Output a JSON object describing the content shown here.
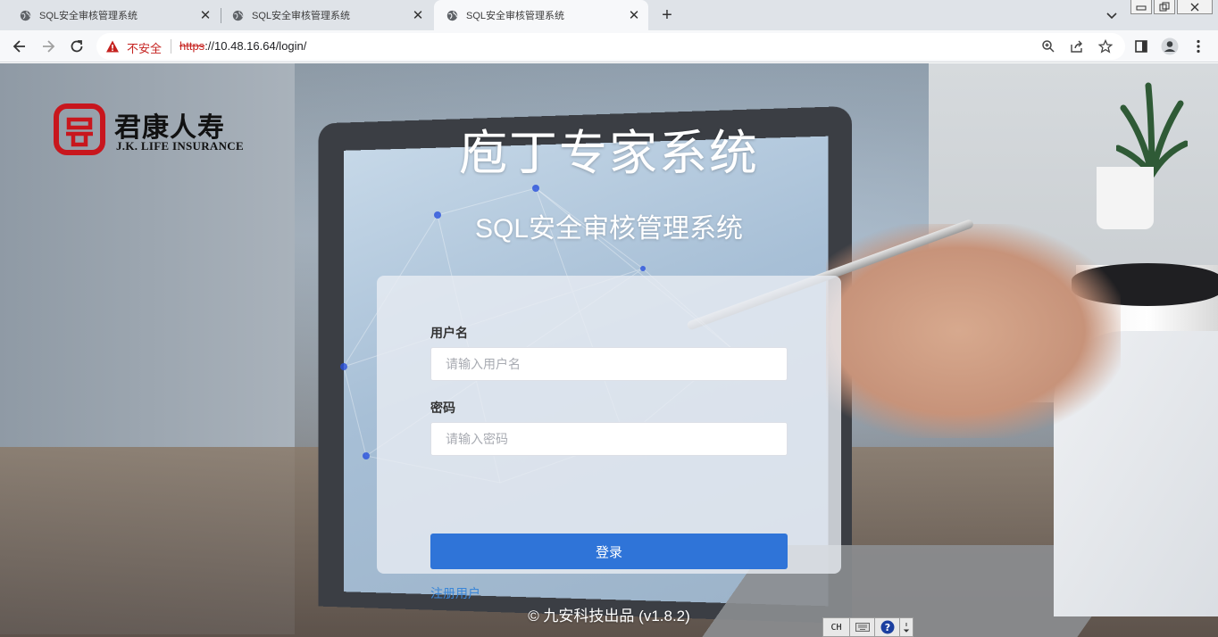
{
  "browser": {
    "tabs": [
      {
        "title": "SQL安全审核管理系统",
        "active": false
      },
      {
        "title": "SQL安全审核管理系统",
        "active": false
      },
      {
        "title": "SQL安全审核管理系统",
        "active": true
      }
    ],
    "security_label": "不安全",
    "url": {
      "scheme": "https",
      "rest": "://10.48.16.64/login/"
    }
  },
  "logo": {
    "chinese_name": "君康人寿",
    "english_name": "J.K. LIFE INSURANCE"
  },
  "main_title": "庖丁专家系统",
  "sub_title": "SQL安全审核管理系统",
  "login_form": {
    "username_label": "用户名",
    "username_placeholder": "请输入用户名",
    "username_value": "",
    "password_label": "密码",
    "password_placeholder": "请输入密码",
    "password_value": "",
    "submit_label": "登录",
    "register_label": "注册用户"
  },
  "footer": "© 九安科技出品 (v1.8.2)",
  "ime": {
    "mode": "CH"
  },
  "colors": {
    "primary_button": "#2f74d8",
    "link": "#3a86d8",
    "insecure_red": "#c5221f",
    "logo_red": "#c8161d"
  }
}
